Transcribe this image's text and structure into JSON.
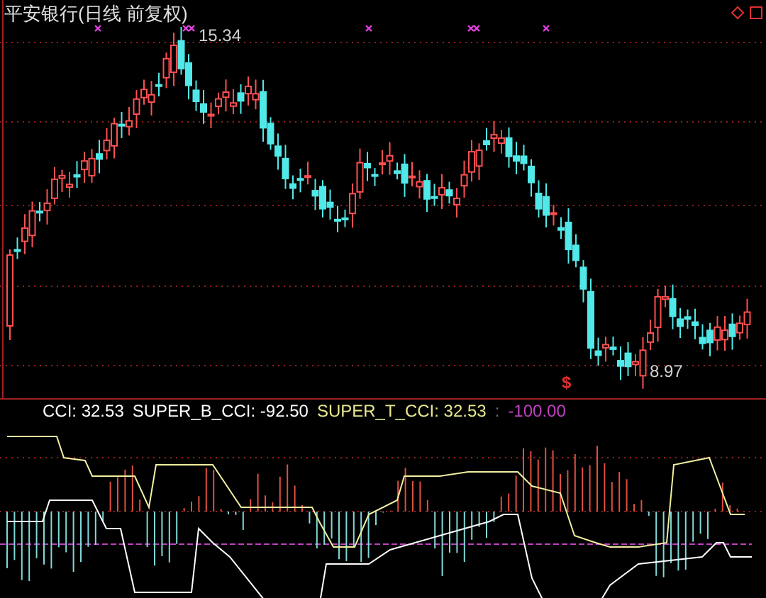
{
  "price_chart": {
    "title": "平安银行(日线 前复权)",
    "high_label": "15.34",
    "low_label": "8.97",
    "signal": "$"
  },
  "indicator": {
    "legend": [
      {
        "text": "CCI: 32.53",
        "color": "#ffffff"
      },
      {
        "text": "SUPER_B_CCI: -92.50",
        "color": "#ffffff"
      },
      {
        "text": "SUPER_T_CCI: 32.53",
        "color": "#e8e890"
      },
      {
        "text": ":",
        "color": "#707070"
      },
      {
        "text": "-100.00",
        "color": "#c040c0"
      }
    ]
  }
}
